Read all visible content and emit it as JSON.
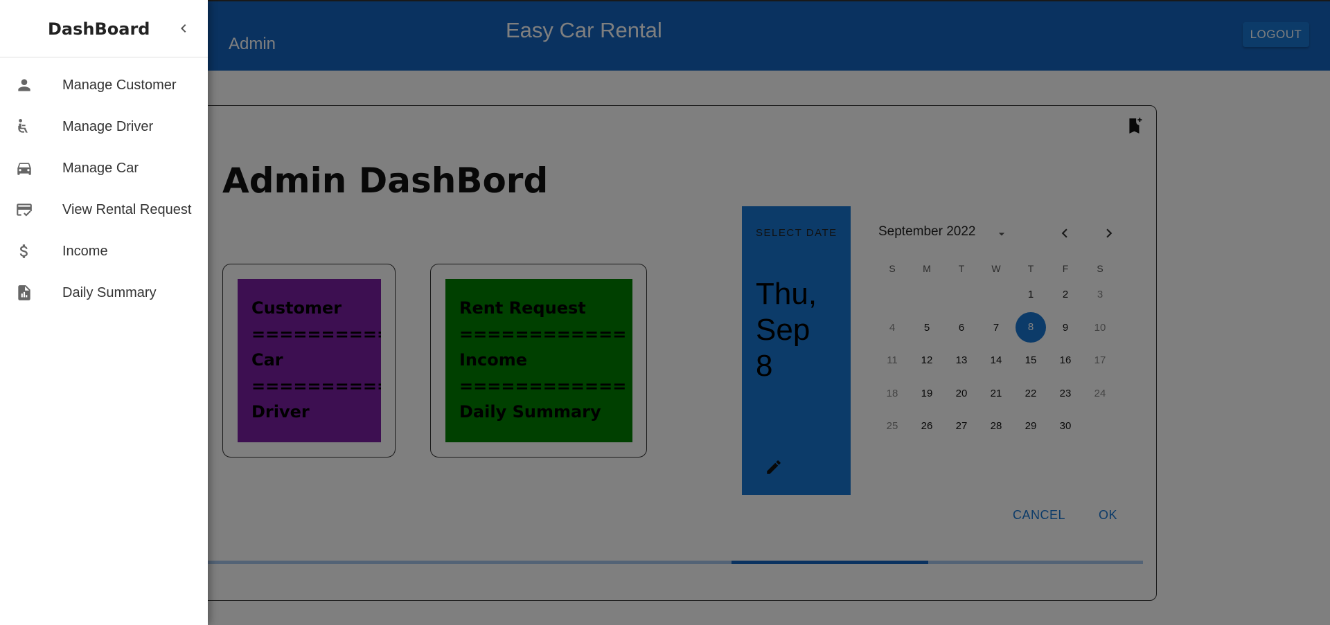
{
  "header": {
    "admin_label": "Admin",
    "app_title": "Easy Car Rental",
    "logout_label": "LOGOUT"
  },
  "main": {
    "page_title": "Admin DashBord",
    "box1": {
      "lines": [
        "Customer",
        "============",
        "Car",
        "============",
        "Driver"
      ],
      "color": "#7b1fa2"
    },
    "box2": {
      "lines": [
        "Rent Request",
        "============",
        "Income",
        "============",
        "Daily Summary"
      ],
      "color": "#008000"
    },
    "bookmark_icon": "bookmark-add-icon"
  },
  "date_picker": {
    "header_label": "SELECT DATE",
    "selected_display": "Thu, Sep 8",
    "month_label": "September 2022",
    "weekdays": [
      "S",
      "M",
      "T",
      "W",
      "T",
      "F",
      "S"
    ],
    "weeks": [
      [
        "",
        "",
        "",
        "",
        "1",
        "2",
        "3"
      ],
      [
        "4",
        "5",
        "6",
        "7",
        "8",
        "9",
        "10"
      ],
      [
        "11",
        "12",
        "13",
        "14",
        "15",
        "16",
        "17"
      ],
      [
        "18",
        "19",
        "20",
        "21",
        "22",
        "23",
        "24"
      ],
      [
        "25",
        "26",
        "27",
        "28",
        "29",
        "30",
        ""
      ]
    ],
    "selected_day": "8",
    "cancel_label": "CANCEL",
    "ok_label": "OK",
    "accent": "#1976d2"
  },
  "progress": {
    "start": 0.56,
    "end": 0.77
  },
  "drawer": {
    "title": "DashBoard",
    "items": [
      {
        "label": "Manage Customer",
        "icon": "person-icon"
      },
      {
        "label": "Manage Driver",
        "icon": "accessible-icon"
      },
      {
        "label": "Manage Car",
        "icon": "car-icon"
      },
      {
        "label": "View Rental Request",
        "icon": "credit-score-icon"
      },
      {
        "label": "Income",
        "icon": "dollar-icon"
      },
      {
        "label": "Daily Summary",
        "icon": "summary-icon"
      }
    ]
  },
  "colors": {
    "brand": "#1565c0",
    "overlay": "rgba(0,0,0,0.5)"
  }
}
